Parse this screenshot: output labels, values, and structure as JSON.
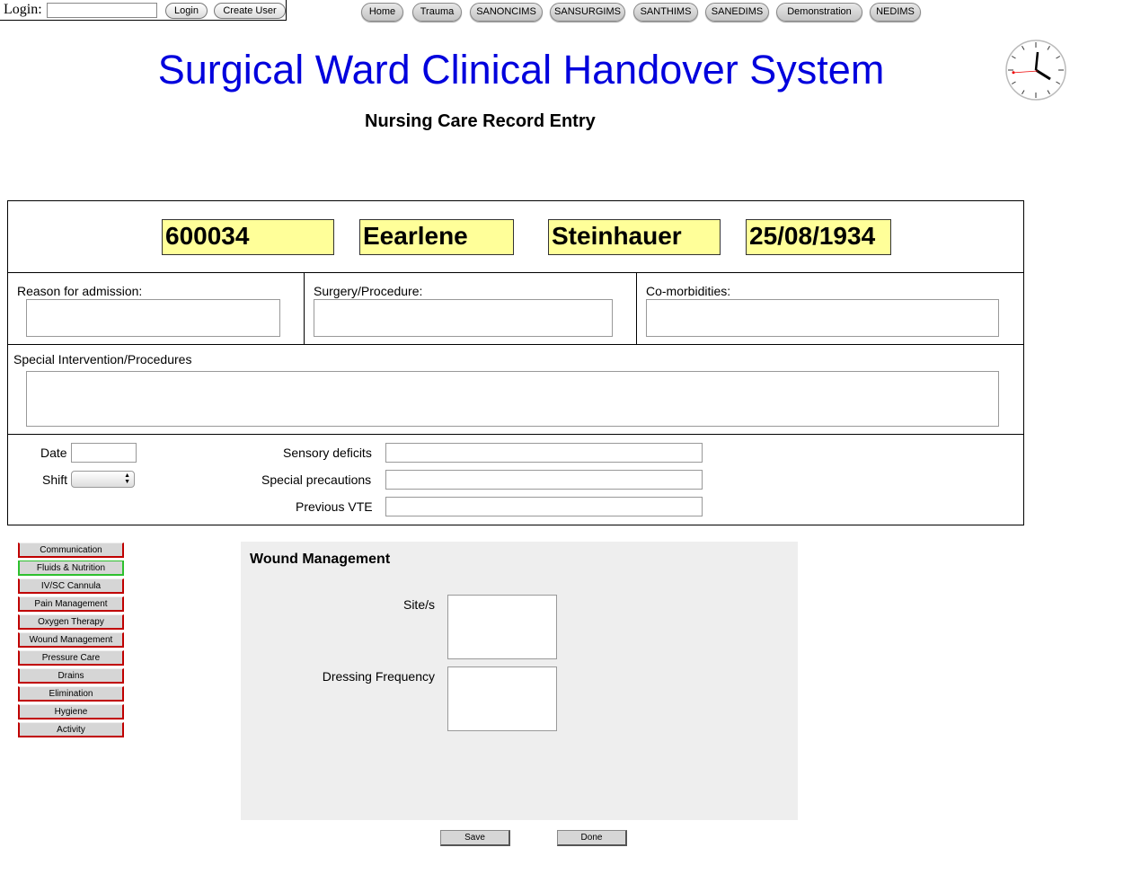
{
  "login": {
    "label": "Login:",
    "input_value": "",
    "login_button": "Login",
    "create_user_button": "Create User"
  },
  "nav": {
    "items": [
      "Home",
      "Trauma",
      "SANONCIMS",
      "SANSURGIMS",
      "SANTHIMS",
      "SANEDIMS",
      "Demonstration",
      "NEDIMS"
    ]
  },
  "header": {
    "title": "Surgical Ward Clinical Handover System",
    "subtitle": "Nursing Care Record Entry"
  },
  "patient": {
    "id": "600034",
    "first_name": "Eearlene",
    "last_name": "Steinhauer",
    "dob": "25/08/1934"
  },
  "fields": {
    "reason_label": "Reason for admission:",
    "surgery_label": "Surgery/Procedure:",
    "comorbidities_label": "Co-morbidities:",
    "special_intervention_label": "Special Intervention/Procedures",
    "date_label": "Date",
    "shift_label": "Shift",
    "sensory_label": "Sensory deficits",
    "precautions_label": "Special precautions",
    "vte_label": "Previous VTE"
  },
  "menu": {
    "items": [
      "Communication",
      "Fluids & Nutrition",
      "IV/SC Cannula",
      "Pain Management",
      "Oxygen Therapy",
      "Wound Management",
      "Pressure Care",
      "Drains",
      "Elimination",
      "Hygiene",
      "Activity"
    ],
    "active_index": 1,
    "active_border_color": "#2ec02e",
    "inactive_border_color": "#c00000"
  },
  "panel": {
    "title": "Wound Management",
    "site_label": "Site/s",
    "dressing_label": "Dressing Frequency"
  },
  "actions": {
    "save": "Save",
    "done": "Done"
  },
  "colors": {
    "title": "#0000dd",
    "patient_field_bg": "#ffff99"
  }
}
